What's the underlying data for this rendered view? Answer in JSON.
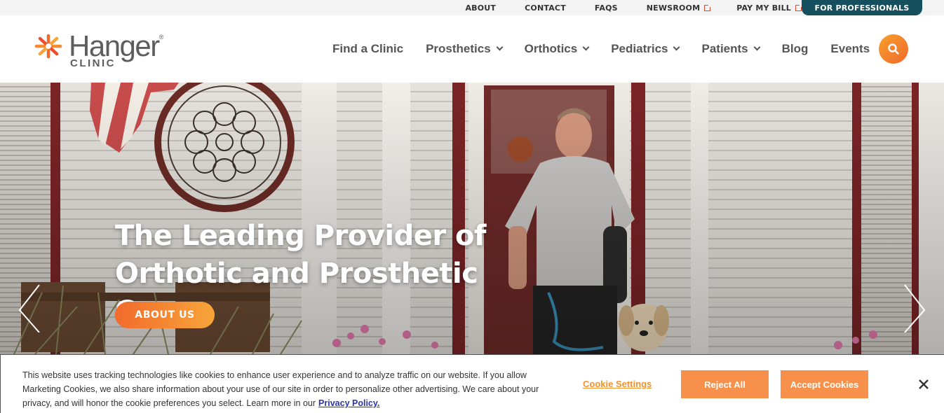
{
  "utility_nav": {
    "items": [
      {
        "label": "ABOUT",
        "external": false
      },
      {
        "label": "CONTACT",
        "external": false
      },
      {
        "label": "FAQS",
        "external": false
      },
      {
        "label": "NEWSROOM",
        "external": true
      },
      {
        "label": "PAY MY BILL",
        "external": true
      }
    ],
    "professionals_label": "FOR PROFESSIONALS",
    "external_icon": "external-link-icon"
  },
  "brand": {
    "wordmark": "Hanger",
    "trademark": "®",
    "subline": "CLINIC",
    "logo_icon": "starburst-logo-icon"
  },
  "main_nav": {
    "items": [
      {
        "label": "Find a Clinic",
        "dropdown": false
      },
      {
        "label": "Prosthetics",
        "dropdown": true
      },
      {
        "label": "Orthotics",
        "dropdown": true
      },
      {
        "label": "Pediatrics",
        "dropdown": true
      },
      {
        "label": "Patients",
        "dropdown": true
      },
      {
        "label": "Blog",
        "dropdown": false
      },
      {
        "label": "Events",
        "dropdown": false
      }
    ],
    "search_icon": "search-icon"
  },
  "hero": {
    "title_line1": "The Leading Provider of",
    "title_line2": "Orthotic and Prosthetic Care",
    "cta_label": "ABOUT US",
    "prev_icon": "chevron-left-icon",
    "next_icon": "chevron-right-icon"
  },
  "cookie_banner": {
    "text": "This website uses tracking technologies like cookies to enhance user experience and to analyze traffic on our website. If you allow Marketing Cookies, we also share information about your use of our site in order to personalize other advertising. We care about your privacy, and will honor the cookie preferences you select. Learn more in our",
    "privacy_link": "Privacy Policy.",
    "settings_label": "Cookie Settings",
    "reject_label": "Reject All",
    "accept_label": "Accept Cookies",
    "close_icon": "close-icon"
  },
  "colors": {
    "brand_orange": "#f26a2b",
    "brand_teal": "#16505f",
    "button_orange": "#f7904a",
    "link_blue": "#2a35a8",
    "nav_text": "#555555"
  }
}
